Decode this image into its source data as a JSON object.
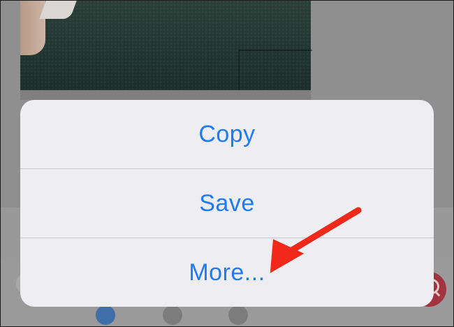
{
  "background": {
    "photo_description_icon": "photo-thumbnail",
    "search_icon": "search-icon"
  },
  "share_menu": {
    "items": [
      {
        "label": "Copy"
      },
      {
        "label": "Save"
      },
      {
        "label": "More..."
      }
    ]
  },
  "annotation": {
    "arrow_color": "#f0291a",
    "points_to": "More..."
  },
  "colors": {
    "accent": "#1f7bf1",
    "menu_bg": "#eeedf1",
    "overlay": "#8f8f8f"
  }
}
